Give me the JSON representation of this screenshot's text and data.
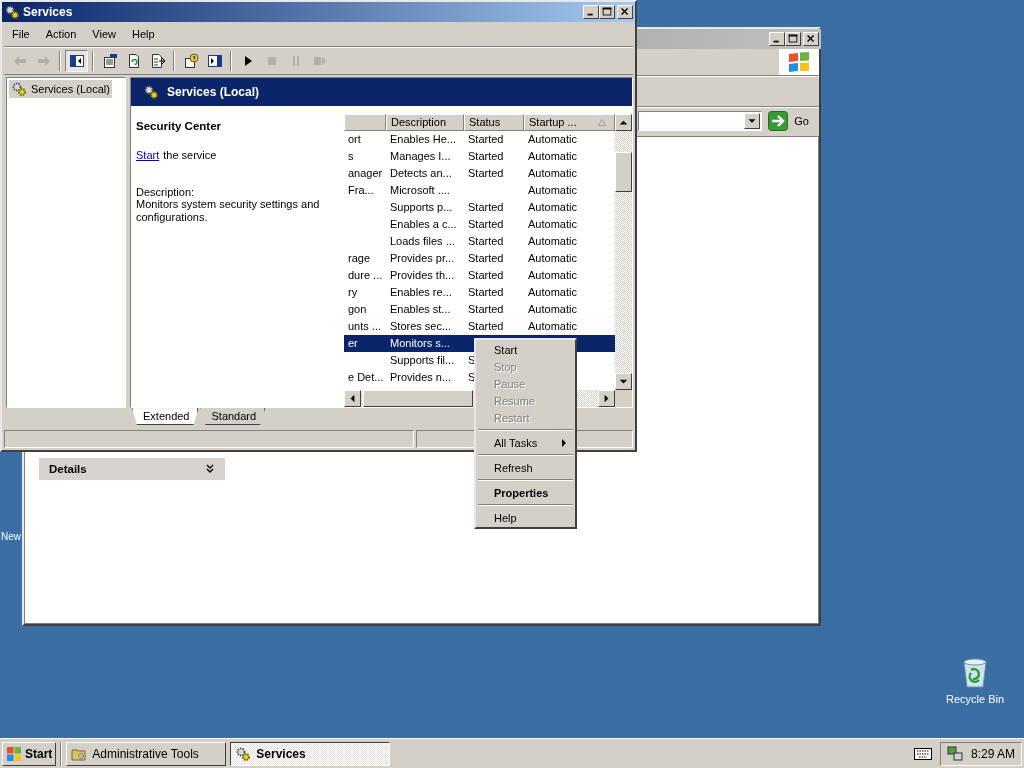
{
  "desktop_icons": [
    {
      "label": "New",
      "kind": "partial"
    },
    {
      "label": "Recycle Bin",
      "kind": "recycle"
    }
  ],
  "explorer_window": {
    "go_button": "Go",
    "details_panel": {
      "title": "Details"
    }
  },
  "services_window": {
    "title": "Services",
    "menu": [
      "File",
      "Action",
      "View",
      "Help"
    ],
    "toolbar": [
      {
        "kind": "back",
        "disabled": true,
        "pressed": false
      },
      {
        "kind": "forward",
        "disabled": true,
        "pressed": false
      },
      {
        "kind": "separator"
      },
      {
        "kind": "tree",
        "disabled": false,
        "pressed": true
      },
      {
        "kind": "separator"
      },
      {
        "kind": "properties",
        "disabled": false,
        "pressed": false
      },
      {
        "kind": "refresh",
        "disabled": false,
        "pressed": false
      },
      {
        "kind": "export",
        "disabled": false,
        "pressed": false
      },
      {
        "kind": "separator"
      },
      {
        "kind": "help",
        "disabled": false,
        "pressed": false
      },
      {
        "kind": "pane",
        "disabled": false,
        "pressed": false
      },
      {
        "kind": "separator"
      },
      {
        "kind": "play",
        "disabled": false,
        "pressed": false
      },
      {
        "kind": "stop",
        "disabled": true,
        "pressed": false
      },
      {
        "kind": "pause",
        "disabled": true,
        "pressed": false
      },
      {
        "kind": "restart",
        "disabled": true,
        "pressed": false
      }
    ],
    "tree": [
      {
        "label": "Services (Local)",
        "selected": true
      }
    ],
    "pane_title": "Services (Local)",
    "details": {
      "service_name": "Security Center",
      "action_link": "Start",
      "action_text": "the service",
      "description_label": "Description:",
      "description": "Monitors system security settings and configurations."
    },
    "columns": [
      {
        "label": "Description",
        "sorted": false
      },
      {
        "label": "Status",
        "sorted": false
      },
      {
        "label": "Startup ...",
        "sorted": true
      }
    ],
    "rows": [
      {
        "column_1": "ort",
        "description": "Enables He...",
        "status": "Started",
        "startup": "Automatic",
        "selected": false
      },
      {
        "column_1": "s",
        "description": "Manages I...",
        "status": "Started",
        "startup": "Automatic",
        "selected": false
      },
      {
        "column_1": "anager",
        "description": "Detects an...",
        "status": "Started",
        "startup": "Automatic",
        "selected": false
      },
      {
        "column_1": "Fra...",
        "description": "Microsoft ....",
        "startup": "Automatic",
        "selected": false
      },
      {
        "description": "Supports p...",
        "status": "Started",
        "startup": "Automatic",
        "selected": false
      },
      {
        "description": "Enables a c...",
        "status": "Started",
        "startup": "Automatic",
        "selected": false
      },
      {
        "description": "Loads files ...",
        "status": "Started",
        "startup": "Automatic",
        "selected": false
      },
      {
        "column_1": "rage",
        "description": "Provides pr...",
        "status": "Started",
        "startup": "Automatic",
        "selected": false
      },
      {
        "column_1": "dure ...",
        "description": "Provides th...",
        "status": "Started",
        "startup": "Automatic",
        "selected": false
      },
      {
        "column_1": "ry",
        "description": "Enables re...",
        "status": "Started",
        "startup": "Automatic",
        "selected": false
      },
      {
        "column_1": "gon",
        "description": "Enables st...",
        "status": "Started",
        "startup": "Automatic",
        "selected": false
      },
      {
        "column_1": "unts ...",
        "description": "Stores sec...",
        "status": "Started",
        "startup": "Automatic",
        "selected": false
      },
      {
        "column_1": "er",
        "description": "Monitors s...",
        "selected": true
      },
      {
        "description": "Supports fil...",
        "status": "S",
        "selected": false
      },
      {
        "column_1": "e Det...",
        "description": "Provides n...",
        "status": "S",
        "selected": false
      }
    ],
    "tabs": [
      {
        "label": "Extended",
        "selected": true
      },
      {
        "label": "Standard",
        "selected": false
      }
    ]
  },
  "context_menu": [
    {
      "kind": "item",
      "label": "Start",
      "disabled": false,
      "default": false,
      "submenu": false
    },
    {
      "kind": "item",
      "label": "Stop",
      "disabled": true,
      "default": false,
      "submenu": false
    },
    {
      "kind": "item",
      "label": "Pause",
      "disabled": true,
      "default": false,
      "submenu": false
    },
    {
      "kind": "item",
      "label": "Resume",
      "disabled": true,
      "default": false,
      "submenu": false
    },
    {
      "kind": "item",
      "label": "Restart",
      "disabled": true,
      "default": false,
      "submenu": false
    },
    {
      "kind": "separator"
    },
    {
      "kind": "item",
      "label": "All Tasks",
      "disabled": false,
      "default": false,
      "submenu": true
    },
    {
      "kind": "separator"
    },
    {
      "kind": "item",
      "label": "Refresh",
      "disabled": false,
      "default": false,
      "submenu": false
    },
    {
      "kind": "separator"
    },
    {
      "kind": "item",
      "label": "Properties",
      "disabled": false,
      "default": true,
      "submenu": false
    },
    {
      "kind": "separator"
    },
    {
      "kind": "item",
      "label": "Help",
      "disabled": false,
      "default": false,
      "submenu": false
    }
  ],
  "taskbar": {
    "start": "Start",
    "buttons": [
      {
        "label": "Administrative Tools",
        "kind": "folder",
        "selected": false
      },
      {
        "label": "Services",
        "kind": "gears",
        "selected": true
      }
    ],
    "clock": "8:29 AM"
  }
}
